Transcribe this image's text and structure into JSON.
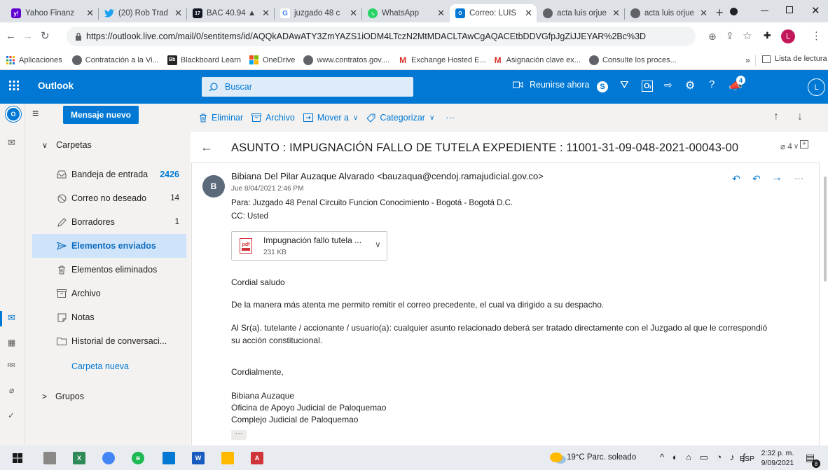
{
  "browser": {
    "tabs": [
      {
        "title": "Yahoo Finanz",
        "fav_color": "#6001d2",
        "fav_text": "y!"
      },
      {
        "title": "(20) Rob Trad",
        "fav_color": "#1da1f2",
        "fav_text": ""
      },
      {
        "title": "BAC 40.94 ▲",
        "fav_color": "#131722",
        "fav_text": "17"
      },
      {
        "title": "juzgado 48 c",
        "fav_color": "#ffffff",
        "fav_text": "G"
      },
      {
        "title": "WhatsApp",
        "fav_color": "#25d366",
        "fav_text": ""
      },
      {
        "title": "Correo: LUIS",
        "fav_color": "#0078d4",
        "fav_text": "O"
      },
      {
        "title": "acta luis orjue",
        "fav_color": "#5f6368",
        "fav_text": ""
      },
      {
        "title": "acta luis orjue",
        "fav_color": "#5f6368",
        "fav_text": ""
      }
    ],
    "new_tab": "+",
    "url": "https://outlook.live.com/mail/0/sentitems/id/AQQkADAwATY3ZmYAZS1iODM4LTczN2MtMDACLTAwCgAQACEtbDDVGfpJgZiJJEYAR%2Bc%3D",
    "profile_initial": "L",
    "bookmarks": [
      {
        "label": "Aplicaciones",
        "icon": "apps-grid"
      },
      {
        "label": "Contratación a la Vi...",
        "icon": "globe"
      },
      {
        "label": "Blackboard Learn",
        "icon": "blackboard"
      },
      {
        "label": "OneDrive",
        "icon": "ms-logo"
      },
      {
        "label": "www.contratos.gov....",
        "icon": "globe"
      },
      {
        "label": "Exchange Hosted E...",
        "icon": "gmail"
      },
      {
        "label": "Asignación clave ex...",
        "icon": "gmail"
      },
      {
        "label": "Consulte los proces...",
        "icon": "globe"
      }
    ],
    "bookmarks_overflow": "»",
    "reading_list": "Lista de lectura"
  },
  "outlook": {
    "app_name": "Outlook",
    "search_placeholder": "Buscar",
    "meet_now": "Reunirse ahora",
    "notification_count": "4",
    "user_initial": "L",
    "new_message": "Mensaje nuevo",
    "commands": {
      "delete": "Eliminar",
      "archive": "Archivo",
      "move_to": "Mover a",
      "categorize": "Categorizar",
      "more": "···"
    },
    "folders_header": "Carpetas",
    "folders": [
      {
        "name": "Bandeja de entrada",
        "count": "2426",
        "icon": "inbox"
      },
      {
        "name": "Correo no deseado",
        "count": "14",
        "icon": "junk"
      },
      {
        "name": "Borradores",
        "count": "1",
        "icon": "drafts"
      },
      {
        "name": "Elementos enviados",
        "count": "",
        "icon": "sent"
      },
      {
        "name": "Elementos eliminados",
        "count": "",
        "icon": "trash"
      },
      {
        "name": "Archivo",
        "count": "",
        "icon": "archive"
      },
      {
        "name": "Notas",
        "count": "",
        "icon": "notes"
      },
      {
        "name": "Historial de conversaci...",
        "count": "",
        "icon": "history"
      }
    ],
    "new_folder": "Carpeta nueva",
    "groups_header": "Grupos"
  },
  "message": {
    "subject": "ASUNTO : IMPUGNACIÓN FALLO DE TUTELA EXPEDIENTE : 11001-31-09-048-2021-00043-00",
    "thread_count": "4",
    "avatar_initial": "B",
    "sender": "Bibiana Del Pilar Auzaque Alvarado <bauzaqua@cendoj.ramajudicial.gov.co>",
    "date": "Jue 8/04/2021 2:46 PM",
    "to": "Para:  Juzgado 48 Penal Circuito Funcion Conocimiento - Bogotá - Bogotá D.C.",
    "cc": "CC:  Usted",
    "attachment_name": "Impugnación fallo tutela ...",
    "attachment_size": "231 KB",
    "body": [
      "Cordial saludo",
      "De la manera más atenta me permito remitir el correo precedente, el cual va dirigido a su despacho.",
      "Al Sr(a). tutelante / accionante / usuario(a):  cualquier asunto relacionado deberá ser tratado directamente con el Juzgado al que le correspondió",
      "su acción constitucional.",
      "Cordialmente,",
      "Bibiana Auzaque",
      "Oficina de Apoyo Judicial de Paloquemao",
      "Complejo Judicial de Paloquemao"
    ],
    "expand": "···"
  },
  "taskbar": {
    "weather": "19°C  Parc. soleado",
    "lang": "ESP",
    "time": "2:32 p. m.",
    "date": "9/09/2021",
    "notif_badge": "8"
  }
}
